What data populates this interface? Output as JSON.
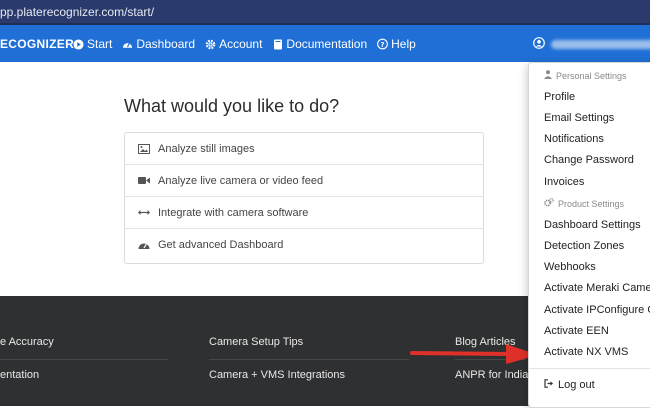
{
  "browser": {
    "url": "pp.platerecognizer.com/start/"
  },
  "navbar": {
    "brand": "ECOGNIZER",
    "items": [
      {
        "label": "Start",
        "icon": "play-circle-icon"
      },
      {
        "label": "Dashboard",
        "icon": "dashboard-icon"
      },
      {
        "label": "Account",
        "icon": "gear-icon"
      },
      {
        "label": "Documentation",
        "icon": "book-icon"
      },
      {
        "label": "Help",
        "icon": "question-circle-icon"
      }
    ],
    "user_icon": "user-circle-icon"
  },
  "main": {
    "title": "What would you like to do?",
    "options": [
      {
        "label": "Analyze still images",
        "icon": "image-icon"
      },
      {
        "label": "Analyze live camera or video feed",
        "icon": "video-camera-icon"
      },
      {
        "label": "Integrate with camera software",
        "icon": "arrows-horizontal-icon"
      },
      {
        "label": "Get advanced Dashboard",
        "icon": "tachometer-icon"
      }
    ]
  },
  "footer": {
    "col1": [
      "e Accuracy",
      "entation"
    ],
    "col2": [
      "Camera Setup Tips",
      "Camera + VMS Integrations"
    ],
    "col3": [
      "Blog Articles",
      "ANPR for India"
    ]
  },
  "dropdown": {
    "personal_header": "Personal Settings",
    "personal_items": [
      "Profile",
      "Email Settings",
      "Notifications",
      "Change Password",
      "Invoices"
    ],
    "product_header": "Product Settings",
    "product_items": [
      "Dashboard Settings",
      "Detection Zones",
      "Webhooks",
      "Activate Meraki Camer",
      "Activate IPConfigure O",
      "Activate EEN",
      "Activate NX VMS"
    ],
    "logout": "Log out"
  },
  "colors": {
    "navbar": "#1f6fd6",
    "urlbar": "#2a3a6c",
    "footer": "#2f3031",
    "arrow": "#e0302a"
  }
}
